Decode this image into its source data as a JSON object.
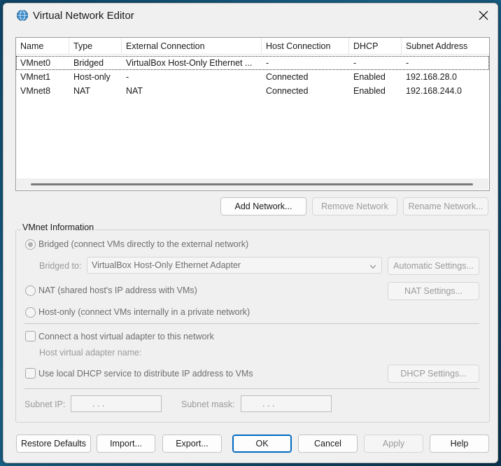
{
  "window": {
    "title": "Virtual Network Editor"
  },
  "table": {
    "columns": [
      "Name",
      "Type",
      "External Connection",
      "Host Connection",
      "DHCP",
      "Subnet Address"
    ],
    "rows": [
      [
        "VMnet0",
        "Bridged",
        "VirtualBox Host-Only Ethernet ...",
        "-",
        "-",
        "-"
      ],
      [
        "VMnet1",
        "Host-only",
        "-",
        "Connected",
        "Enabled",
        "192.168.28.0"
      ],
      [
        "VMnet8",
        "NAT",
        "NAT",
        "Connected",
        "Enabled",
        "192.168.244.0"
      ]
    ]
  },
  "network_buttons": {
    "add": "Add Network...",
    "remove": "Remove Network",
    "rename": "Rename Network..."
  },
  "vmnet_info": {
    "title": "VMnet Information",
    "bridged_label": "Bridged (connect VMs directly to the external network)",
    "bridged_to_label": "Bridged to:",
    "bridged_to_value": "VirtualBox Host-Only Ethernet Adapter",
    "automatic_settings": "Automatic Settings...",
    "nat_label": "NAT (shared host's IP address with VMs)",
    "nat_settings": "NAT Settings...",
    "hostonly_label": "Host-only (connect VMs internally in a private network)",
    "connect_adapter_label": "Connect a host virtual adapter to this network",
    "adapter_name_label": "Host virtual adapter name:",
    "dhcp_label": "Use local DHCP service to distribute IP address to VMs",
    "dhcp_settings": "DHCP Settings...",
    "subnet_ip_label": "Subnet IP:",
    "subnet_ip_value": ".       .       .",
    "subnet_mask_label": "Subnet mask:",
    "subnet_mask_value": ".       .       ."
  },
  "footer": {
    "restore": "Restore Defaults",
    "import": "Import...",
    "export": "Export...",
    "ok": "OK",
    "cancel": "Cancel",
    "apply": "Apply",
    "help": "Help"
  },
  "colors": {
    "accent": "#0067c0",
    "dialog_bg": "#f0f0f0",
    "disabled_text": "#9a9a9a"
  }
}
